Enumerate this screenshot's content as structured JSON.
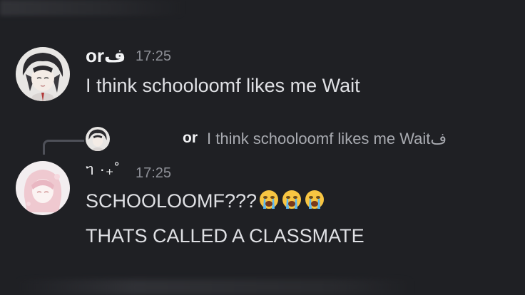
{
  "messages": [
    {
      "username": "orف",
      "time": "17:25",
      "text": "I think schooloomf likes me Wait"
    },
    {
      "username": "ᥐ ·₊˚",
      "time": "17:25",
      "reply": {
        "username": "or",
        "text": "I think schooloomf likes me Waitف"
      },
      "lines": [
        "SCHOOLOOMF???",
        "THATS CALLED A CLASSMATE"
      ],
      "emojis": [
        "loudly-crying-face",
        "loudly-crying-face",
        "loudly-crying-face"
      ]
    }
  ],
  "colors": {
    "background": "#1f2024",
    "text": "#dfe0e4",
    "muted": "#8e9097",
    "reply_text": "#a8aab0"
  }
}
